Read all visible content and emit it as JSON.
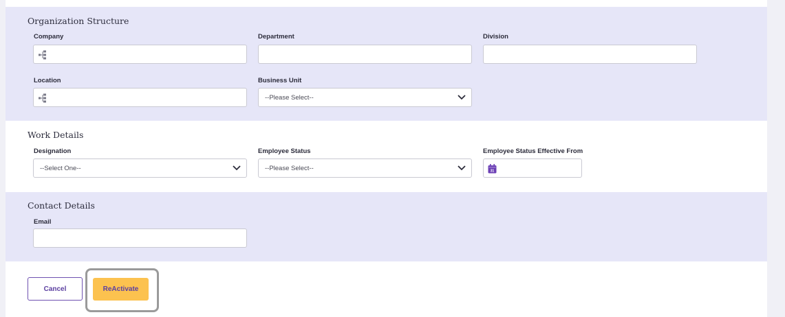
{
  "organization": {
    "title": "Organization Structure",
    "company_label": "Company",
    "company_value": "",
    "department_label": "Department",
    "department_value": "",
    "division_label": "Division",
    "division_value": "",
    "location_label": "Location",
    "location_value": "",
    "business_unit_label": "Business Unit",
    "business_unit_value": "--Please Select--"
  },
  "work": {
    "title": "Work Details",
    "designation_label": "Designation",
    "designation_value": "--Select One--",
    "employee_status_label": "Employee Status",
    "employee_status_value": "--Please Select--",
    "status_effective_label": "Employee Status Effective From",
    "status_effective_value": ""
  },
  "contact": {
    "title": "Contact Details",
    "email_label": "Email",
    "email_value": ""
  },
  "actions": {
    "cancel_label": "Cancel",
    "reactivate_label": "ReActivate"
  },
  "icons": {
    "tree": "org-tree-icon",
    "calendar": "calendar-icon",
    "calendar_day": "31",
    "chevron": "chevron-down-icon"
  },
  "colors": {
    "section_tint": "#e6e6f8",
    "primary_purple": "#5b3fa0",
    "reactivate_yellow": "#fcc24f"
  }
}
